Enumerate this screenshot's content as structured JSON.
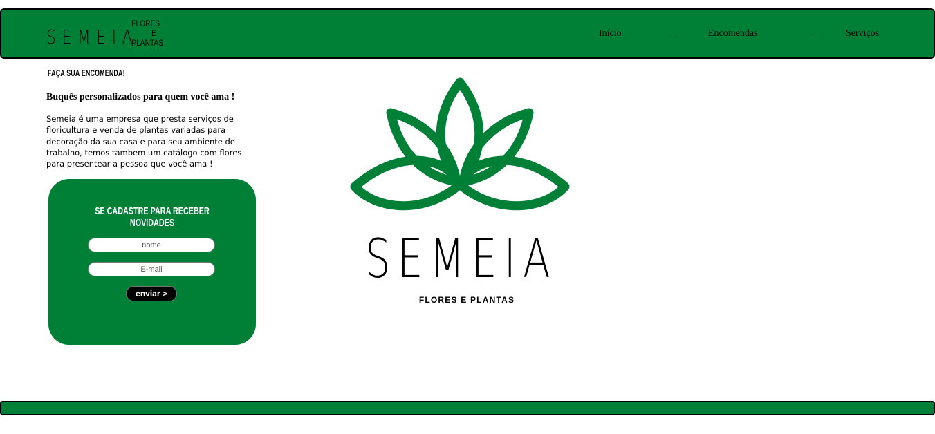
{
  "header": {
    "brand_name": "SEMEIA",
    "brand_sub": [
      "FLORES",
      "E",
      "PLANTAS"
    ],
    "nav": [
      {
        "label": "Início"
      },
      {
        "label": "Encomendas"
      },
      {
        "label": "Serviços"
      }
    ],
    "separator": "_"
  },
  "main": {
    "tagline": "FAÇA SUA ENCOMENDA!",
    "subtitle": "Buquês personalizados para quem você ama !",
    "description": "Semeia é uma empresa que presta serviços de floricultura e venda de plantas variadas para decoração da sua casa e para seu ambiente de trabalho, temos tambem um catálogo com flores para presentear a pessoa que você ama !"
  },
  "signup": {
    "title": "SE CADASTRE PARA RECEBER NOVIDADES",
    "name_placeholder": "nome",
    "email_placeholder": "E-mail",
    "submit_label": "enviar >"
  },
  "logo": {
    "name": "SEMEIA",
    "tagline": "FLORES E PLANTAS",
    "icon": "lotus-icon"
  },
  "colors": {
    "brand_green": "#008036",
    "border": "#000000"
  }
}
